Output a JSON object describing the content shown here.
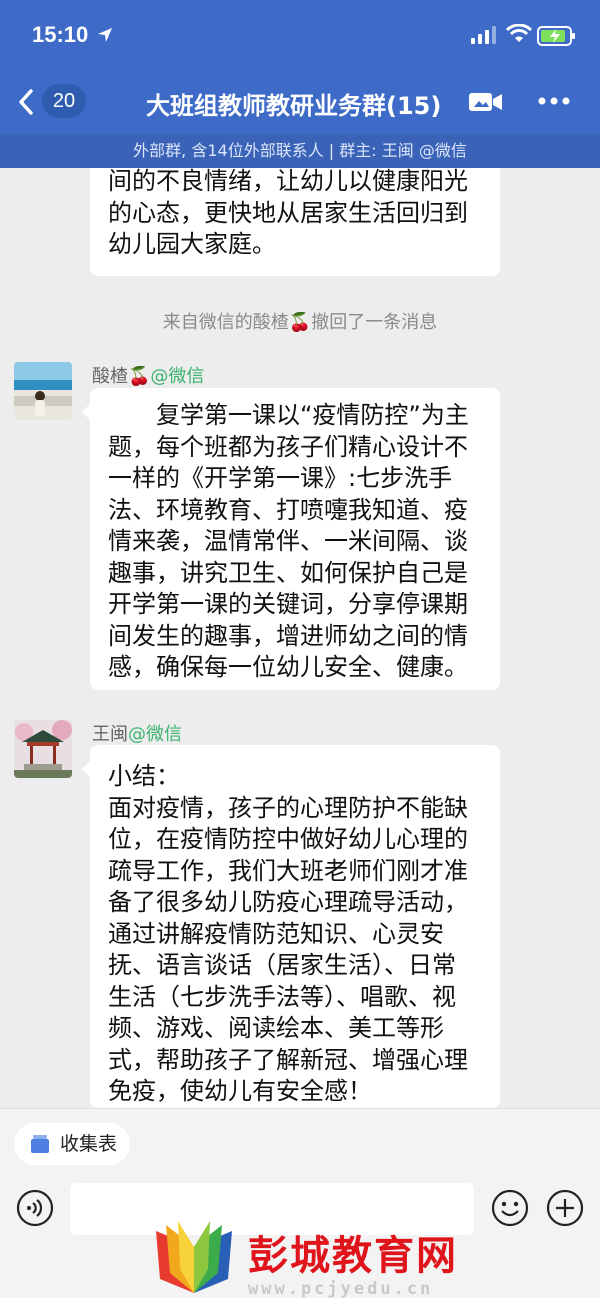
{
  "status": {
    "time": "15:10"
  },
  "nav": {
    "back_count": "20",
    "title": "大班组教师教研业务群(15)",
    "subtitle": "外部群, 含14位外部联系人 | 群主: 王闽 @微信"
  },
  "messages": {
    "partial": {
      "lines": [
        "间的不良情绪，让幼儿以健康阳光",
        "的心态，更快地从居家生活回归到",
        "幼儿园大家庭。"
      ]
    },
    "recall_notice": "来自微信的酸楂🍒撤回了一条消息",
    "msg1": {
      "sender_name": "酸楂🍒",
      "sender_suffix": "@微信",
      "lines": [
        "　　复学第一课以“疫情防控”为主",
        "题，每个班都为孩子们精心设计不",
        "一样的《开学第一课》:七步洗手",
        "法、环境教育、打喷嚏我知道、疫",
        "情来袭，温情常伴、一米间隔、谈",
        "趣事，讲究卫生、如何保护自己是",
        "开学第一课的关键词，分享停课期",
        "间发生的趣事，增进师幼之间的情",
        "感，确保每一位幼儿安全、健康。"
      ]
    },
    "msg2": {
      "sender_name": "王闽",
      "sender_suffix": "@微信",
      "lines": [
        "小结：",
        "面对疫情，孩子的心理防护不能缺",
        "位，在疫情防控中做好幼儿心理的",
        "疏导工作，我们大班老师们刚才准",
        "备了很多幼儿防疫心理疏导活动，",
        "通过讲解疫情防范知识、心灵安",
        "抚、语言谈话（居家生活）、日常",
        "生活（七步洗手法等）、唱歌、视",
        "频、游戏、阅读绘本、美工等形",
        "式，帮助孩子了解新冠、增强心理",
        "免疫，使幼儿有安全感！"
      ]
    }
  },
  "bottom": {
    "collect_label": "收集表"
  },
  "watermark": {
    "brand": "彭城教育网",
    "url": "www.pcjyedu.cn"
  },
  "colors": {
    "header_bg": "#3e6bc8",
    "subbar_bg": "#3a63b7",
    "wechat_green": "#3cb371",
    "watermark_red": "#e0151b"
  }
}
